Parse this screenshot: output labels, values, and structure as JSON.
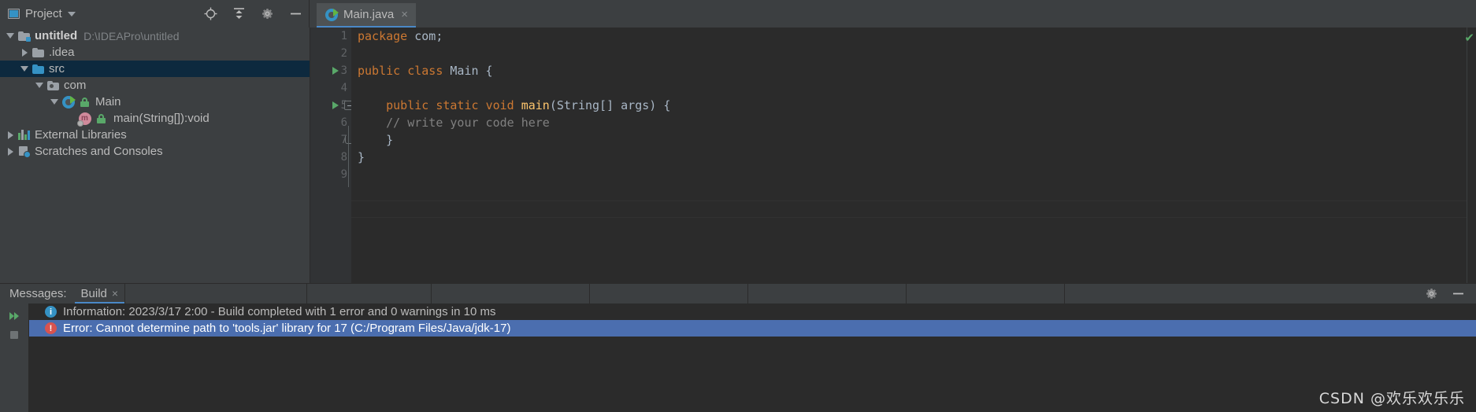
{
  "toolwindow": {
    "title": "Project",
    "icon": "project-icon",
    "actions": [
      {
        "name": "locate-icon",
        "label": "Select Opened File"
      },
      {
        "name": "collapse-all-icon",
        "label": "Collapse All"
      },
      {
        "name": "settings-gear-icon",
        "label": "Options"
      },
      {
        "name": "hide-icon",
        "label": "Hide"
      }
    ]
  },
  "tabs": [
    {
      "label": "Main.java",
      "icon": "java-class-icon",
      "close": "×",
      "active": true
    }
  ],
  "tree": [
    {
      "label": "untitled",
      "path": "D:\\IDEAPro\\untitled",
      "arrow": "down",
      "icon": "module-folder-icon",
      "indent": 0,
      "bold": true,
      "selected": false
    },
    {
      "label": ".idea",
      "path": "",
      "arrow": "right",
      "icon": "folder-grey-icon",
      "indent": 1,
      "bold": false,
      "selected": false
    },
    {
      "label": "src",
      "path": "",
      "arrow": "down",
      "icon": "folder-blue-icon",
      "indent": 1,
      "bold": false,
      "selected": true
    },
    {
      "label": "com",
      "path": "",
      "arrow": "down",
      "icon": "package-folder-icon",
      "indent": 2,
      "bold": false,
      "selected": false
    },
    {
      "label": "Main",
      "path": "",
      "arrow": "down",
      "icon": "java-class-icon",
      "indent": 3,
      "bold": false,
      "selected": false
    },
    {
      "label": "main(String[]):void",
      "path": "",
      "arrow": "none",
      "icon": "method-icon",
      "indent": 4,
      "bold": false,
      "selected": false
    },
    {
      "label": "External Libraries",
      "path": "",
      "arrow": "right",
      "icon": "libraries-icon",
      "indent": 0,
      "bold": false,
      "selected": false
    },
    {
      "label": "Scratches and Consoles",
      "path": "",
      "arrow": "right",
      "icon": "scratches-icon",
      "indent": 0,
      "bold": false,
      "selected": false
    }
  ],
  "editor": {
    "line_numbers": [
      "1",
      "2",
      "3",
      "4",
      "5",
      "6",
      "7",
      "8",
      "9"
    ],
    "lines": [
      [
        {
          "t": "package",
          "c": "kw"
        },
        {
          "t": " com;",
          "c": "ty"
        }
      ],
      [],
      [
        {
          "t": "public",
          "c": "kw"
        },
        {
          "t": " ",
          "c": "ty"
        },
        {
          "t": "class",
          "c": "kw"
        },
        {
          "t": " Main {",
          "c": "ty"
        }
      ],
      [],
      [
        {
          "t": "    ",
          "c": "ty"
        },
        {
          "t": "public",
          "c": "kw"
        },
        {
          "t": " ",
          "c": "ty"
        },
        {
          "t": "static",
          "c": "kw"
        },
        {
          "t": " ",
          "c": "ty"
        },
        {
          "t": "void",
          "c": "kw"
        },
        {
          "t": " ",
          "c": "ty"
        },
        {
          "t": "main",
          "c": "fn"
        },
        {
          "t": "(String[] args) {",
          "c": "ty"
        }
      ],
      [
        {
          "t": "    // write your code here",
          "c": "cm"
        }
      ],
      [
        {
          "t": "    }",
          "c": "ty"
        }
      ],
      [
        {
          "t": "}",
          "c": "ty"
        }
      ],
      []
    ],
    "run_marker_lines": [
      3,
      5
    ],
    "inspection_status": "✔"
  },
  "bottom_panel": {
    "messages_label": "Messages:",
    "tab_label": "Build",
    "tab_close": "×",
    "actions": [
      {
        "name": "settings-gear-icon",
        "label": "Settings"
      },
      {
        "name": "hide-icon",
        "label": "Hide"
      }
    ],
    "side_buttons": [
      {
        "name": "rerun-button",
        "label": "Rerun"
      },
      {
        "name": "stop-button",
        "label": "Stop"
      }
    ],
    "rows": [
      {
        "icon": "info-icon",
        "glyph": "i",
        "text": "Information: 2023/3/17 2:00 - Build completed with 1 error and 0 warnings in 10 ms",
        "selected": false
      },
      {
        "icon": "error-icon",
        "glyph": "!",
        "text": "Error: Cannot determine path to 'tools.jar' library for 17 (C:/Program Files/Java/jdk-17)",
        "selected": true
      }
    ]
  },
  "watermark": "CSDN @欢乐欢乐乐",
  "colors": {
    "accent_blue": "#3592c4",
    "tab_underline": "#4a88c7",
    "selection_blue": "#4b6eaf",
    "tree_selection": "#0d293e",
    "green": "#59a869",
    "error_red": "#d9534f",
    "keyword_orange": "#cc7832",
    "method_yellow": "#ffc66d",
    "editor_bg": "#2b2b2b",
    "panel_bg": "#3c3f41"
  }
}
